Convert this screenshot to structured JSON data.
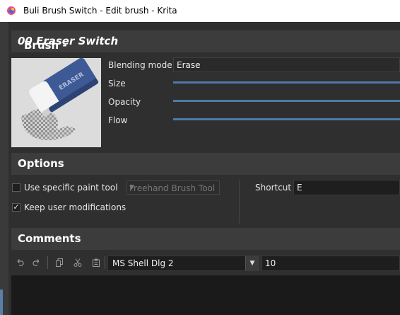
{
  "window": {
    "title": "Buli Brush Switch - Edit brush - Krita"
  },
  "brush_section": {
    "header_prefix": "Brush - ",
    "header_name": "00 Eraser Switch",
    "blending_label": "Blending mode",
    "blending_value": "Erase",
    "size_label": "Size",
    "opacity_label": "Opacity",
    "flow_label": "Flow"
  },
  "options": {
    "header": "Options",
    "use_specific_label": "Use specific paint tool",
    "use_specific_checked": false,
    "tool_value": "Freehand Brush Tool",
    "keep_label": "Keep user modifications",
    "keep_checked": true,
    "check_glyph": "✓",
    "shortcut_label": "Shortcut",
    "shortcut_value": "E"
  },
  "comments": {
    "header": "Comments",
    "font_value": "MS Shell Dlg 2",
    "size_value": "10"
  },
  "colors": {
    "accent": "#4f7aa6",
    "header_bg": "#3c3c3c",
    "panel_bg": "#2f2f2f"
  }
}
